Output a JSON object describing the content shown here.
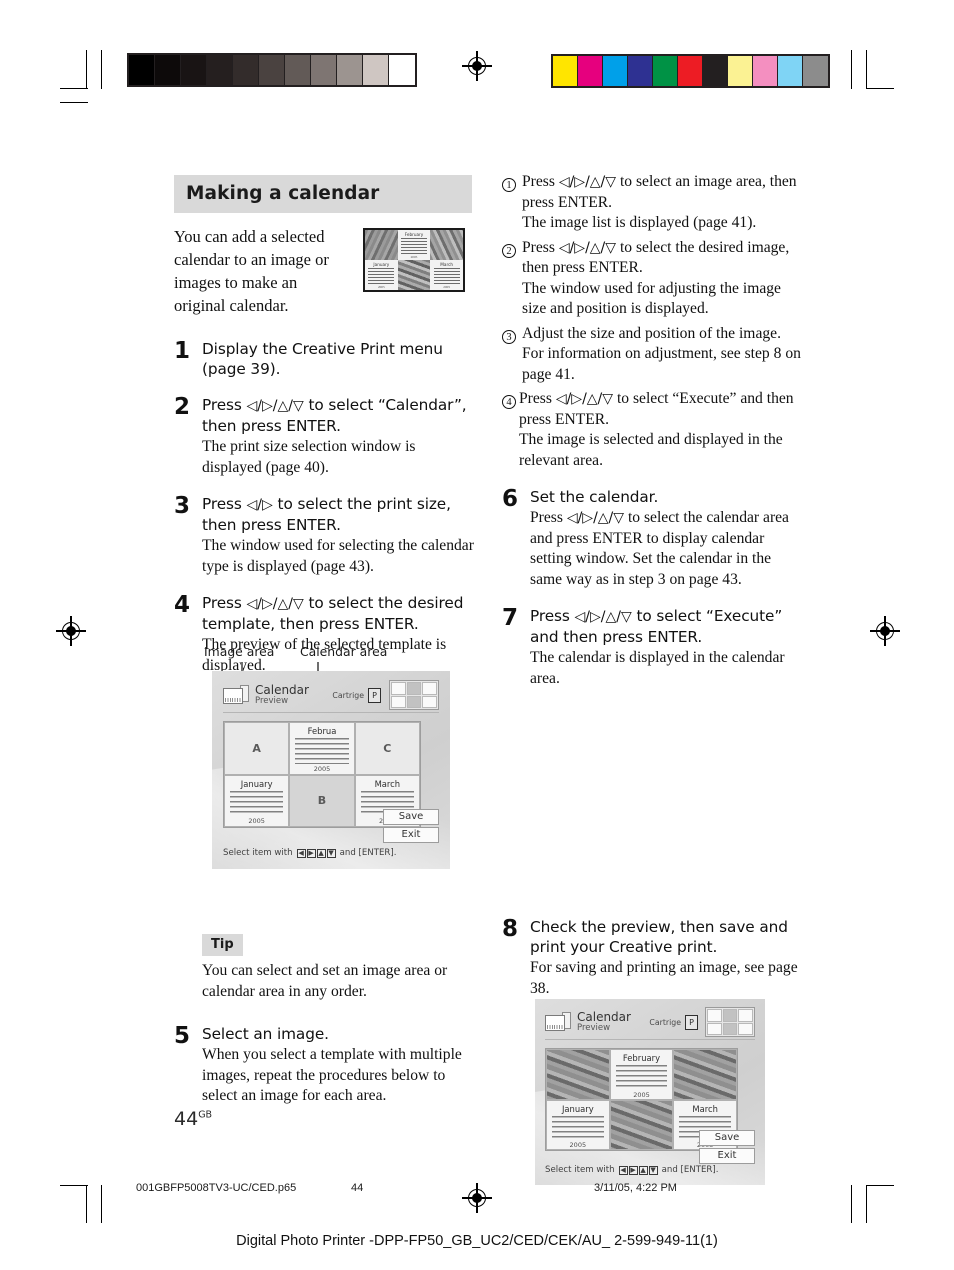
{
  "print_marks": {
    "grayscale_swatches": [
      "#000000",
      "#0d0a0a",
      "#191414",
      "#251f1f",
      "#332c2b",
      "#4a4240",
      "#625a57",
      "#7e7572",
      "#9c9490",
      "#cfc6c2",
      "#ffffff"
    ],
    "color_swatches": [
      "#ffe500",
      "#e6007e",
      "#00a0e9",
      "#2e3192",
      "#009245",
      "#ed1c24",
      "#231f20",
      "#fbf293",
      "#f48fc0",
      "#7fd4f5",
      "#8c8c8c"
    ]
  },
  "section": {
    "title": "Making a calendar",
    "intro": "You can add a selected calendar to an image or images to make an original calendar."
  },
  "thumbnail": {
    "months": [
      "February",
      "January",
      "March"
    ],
    "year": "2005"
  },
  "steps_left": [
    {
      "num": "1",
      "lead": "Display the Creative Print menu (page 39).",
      "desc": ""
    },
    {
      "num": "2",
      "lead_pre": "Press ",
      "arrows": "◁/▷/△/▽",
      "lead_post": " to select “Calendar”, then press ENTER.",
      "desc": "The print size selection window is displayed (page 40)."
    },
    {
      "num": "3",
      "lead_pre": "Press ",
      "arrows": "◁/▷",
      "lead_post": " to select the print size, then press ENTER.",
      "desc": "The window used for selecting the calendar type is displayed (page 43)."
    },
    {
      "num": "4",
      "lead_pre": "Press ",
      "arrows": "◁/▷/△/▽",
      "lead_post": " to select the desired template, then press ENTER.",
      "desc": "The preview of the selected template is displayed."
    }
  ],
  "figure_left": {
    "callout_image_area": "Image area",
    "callout_calendar_area": "Calendar area",
    "screen": {
      "title": "Calendar",
      "subtitle": "Preview",
      "cartridge_label": "Cartrige",
      "cartridge_value": "P",
      "cells": [
        {
          "type": "placeholder",
          "label": "A"
        },
        {
          "type": "calendar",
          "month": "Februa",
          "year": "2005"
        },
        {
          "type": "placeholder",
          "label": "C"
        },
        {
          "type": "calendar",
          "month": "January",
          "year": "2005"
        },
        {
          "type": "placeholder",
          "label": "B"
        },
        {
          "type": "calendar",
          "month": "March",
          "year": "2005"
        }
      ],
      "save_label": "Save",
      "exit_label": "Exit",
      "footer_pre": "Select item with",
      "footer_post": "and [ENTER]."
    }
  },
  "tip": {
    "badge": "Tip",
    "text": "You can select and set an image area or calendar area in any order."
  },
  "step5": {
    "num": "5",
    "lead": "Select an image.",
    "desc": "When you select a template with multiple images, repeat the procedures below to select an image for each area."
  },
  "substeps_right": [
    {
      "marker": "1",
      "pre": "Press ",
      "arrows": "◁/▷/△/▽",
      "post": " to select an image area, then press ENTER.",
      "desc": "The image list is displayed (page 41)."
    },
    {
      "marker": "2",
      "pre": "Press ",
      "arrows": "◁/▷/△/▽",
      "post": " to select the desired image, then press ENTER.",
      "desc": "The window used for adjusting the image size and position is displayed."
    },
    {
      "marker": "3",
      "pre": "Adjust the size and position of the image.",
      "arrows": "",
      "post": "",
      "desc": "For information on adjustment, see step 8 on page 41."
    },
    {
      "marker": "4",
      "pre": "Press ",
      "arrows": "◁/▷/△/▽",
      "post": " to select “Execute” and then press ENTER.",
      "desc": "The image is selected and displayed in the relevant area."
    }
  ],
  "steps_right": [
    {
      "num": "6",
      "lead": "Set the calendar.",
      "desc_pre": "Press  ",
      "arrows": "◁/▷/△/▽",
      "desc_post": " to select the calendar area and press ENTER to display calendar setting window.   Set the calendar in the same way as in step 3 on page 43."
    },
    {
      "num": "7",
      "lead_pre": "Press ",
      "arrows": "◁/▷/△/▽",
      "lead_post": " to select “Execute” and then press ENTER.",
      "desc": "The calendar is displayed in the calendar area."
    }
  ],
  "figure_right": {
    "screen": {
      "title": "Calendar",
      "subtitle": "Preview",
      "cartridge_label": "Cartrige",
      "cartridge_value": "P",
      "cells": [
        {
          "type": "photo",
          "label": ""
        },
        {
          "type": "calendar",
          "month": "February",
          "year": "2005"
        },
        {
          "type": "photo",
          "label": ""
        },
        {
          "type": "calendar",
          "month": "January",
          "year": "2005"
        },
        {
          "type": "photo",
          "label": ""
        },
        {
          "type": "calendar",
          "month": "March",
          "year": "2005"
        }
      ],
      "save_label": "Save",
      "exit_label": "Exit",
      "footer_pre": "Select item with",
      "footer_post": "and [ENTER]."
    }
  },
  "step8": {
    "num": "8",
    "lead": "Check the preview, then save and print your Creative print.",
    "desc": "For saving and printing an image, see page 38."
  },
  "page_footer": {
    "page_number": "44",
    "page_suffix": "GB",
    "file_name": "001GBFP5008TV3-UC/CED.p65",
    "file_page": "44",
    "timestamp": "3/11/05, 4:22 PM",
    "doc_line": "Digital Photo Printer -DPP-FP50_GB_UC2/CED/CEK/AU_ 2-599-949-11(1)"
  }
}
